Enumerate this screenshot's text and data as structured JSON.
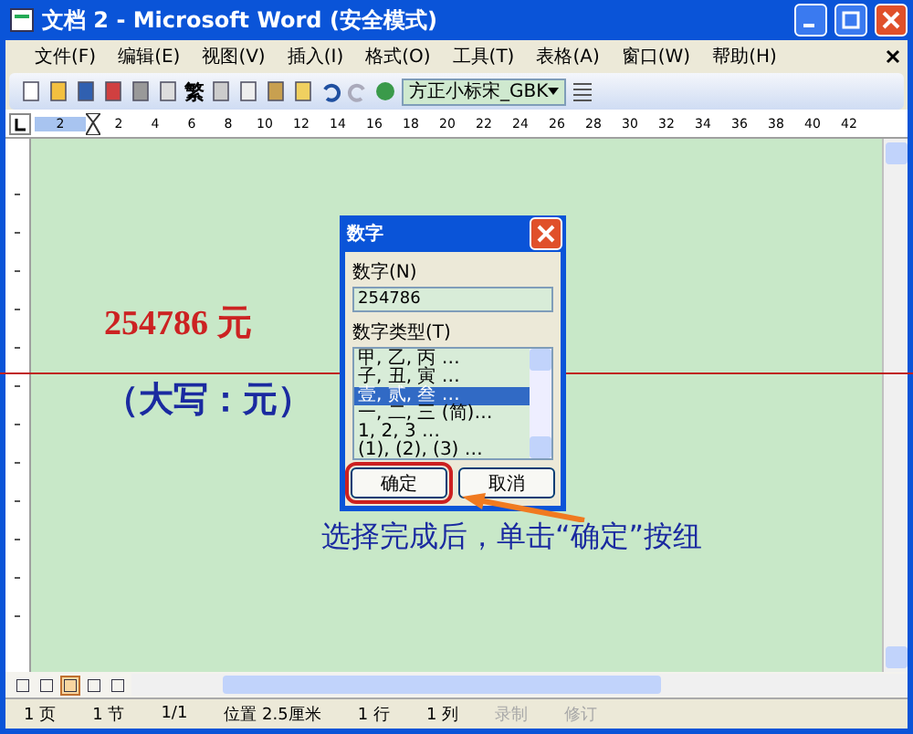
{
  "window": {
    "title": "文档 2 - Microsoft Word (安全模式)"
  },
  "menu": [
    "文件(F)",
    "编辑(E)",
    "视图(V)",
    "插入(I)",
    "格式(O)",
    "工具(T)",
    "表格(A)",
    "窗口(W)",
    "帮助(H)"
  ],
  "toolbar": {
    "convert_label": "繁",
    "font": "方正小标宋_GBK"
  },
  "ruler": {
    "left_label": "2",
    "labels": [
      "2",
      "4",
      "6",
      "8",
      "10",
      "12",
      "14",
      "16",
      "18",
      "20",
      "22",
      "24",
      "26",
      "28",
      "30",
      "32",
      "34",
      "36",
      "38",
      "40",
      "42"
    ]
  },
  "document": {
    "amount": "254786 元",
    "uppercase": "（大写：元）"
  },
  "dialog": {
    "title": "数字",
    "number_label": "数字(N)",
    "number_value": "254786",
    "type_label": "数字类型(T)",
    "types": [
      {
        "label": "甲, 乙, 丙 …",
        "selected": false
      },
      {
        "label": "子, 丑, 寅 …",
        "selected": false
      },
      {
        "label": "壹, 贰, 叁 …",
        "selected": true
      },
      {
        "label": "一, 二, 三 (简)…",
        "selected": false
      },
      {
        "label": "1, 2, 3 …",
        "selected": false
      },
      {
        "label": "(1), (2), (3) …",
        "selected": false
      }
    ],
    "buttons": [
      {
        "label": "确定",
        "highlighted": true
      },
      {
        "label": "取消",
        "highlighted": false
      }
    ]
  },
  "caption": "选择完成后，单击“确定”按纽",
  "status_bar": [
    {
      "label": "1 页",
      "disabled": false
    },
    {
      "label": "1 节",
      "disabled": false
    },
    {
      "label": "1/1",
      "disabled": false
    },
    {
      "label": "位置 2.5厘米",
      "disabled": false
    },
    {
      "label": "1 行",
      "disabled": false
    },
    {
      "label": "1 列",
      "disabled": false
    },
    {
      "label": "录制",
      "disabled": true
    },
    {
      "label": "修订",
      "disabled": true
    }
  ]
}
